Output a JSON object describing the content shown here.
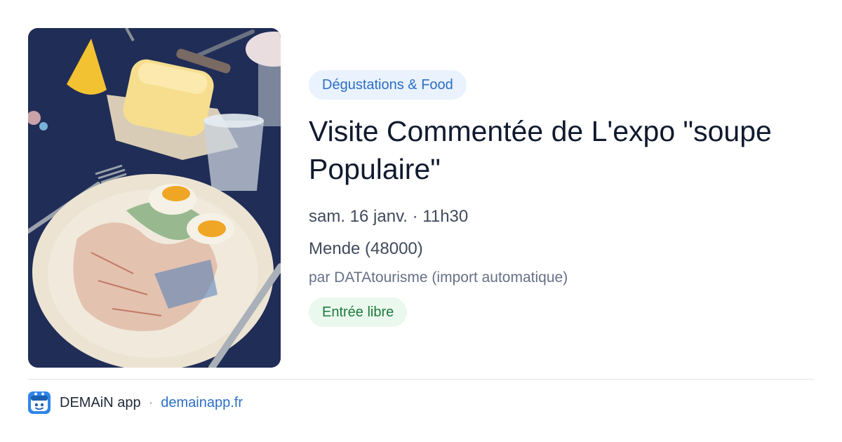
{
  "event": {
    "image_description": "photo-plated-eggs-and-butter",
    "category": "Dégustations & Food",
    "title": "Visite Commentée de L'expo \"soupe Populaire\"",
    "date_time": "sam. 16 janv. · 11h30",
    "location": "Mende (48000)",
    "organizer": "par DATAtourisme (import automatique)",
    "price": "Entrée libre"
  },
  "footer": {
    "app_name": "DEMAiN app",
    "separator": "·",
    "site": "demainapp.fr"
  },
  "colors": {
    "accent": "#2b6fc6",
    "category_bg": "#eaf2fd",
    "price_text": "#1d7a3c",
    "price_bg": "#ebf8ee"
  }
}
